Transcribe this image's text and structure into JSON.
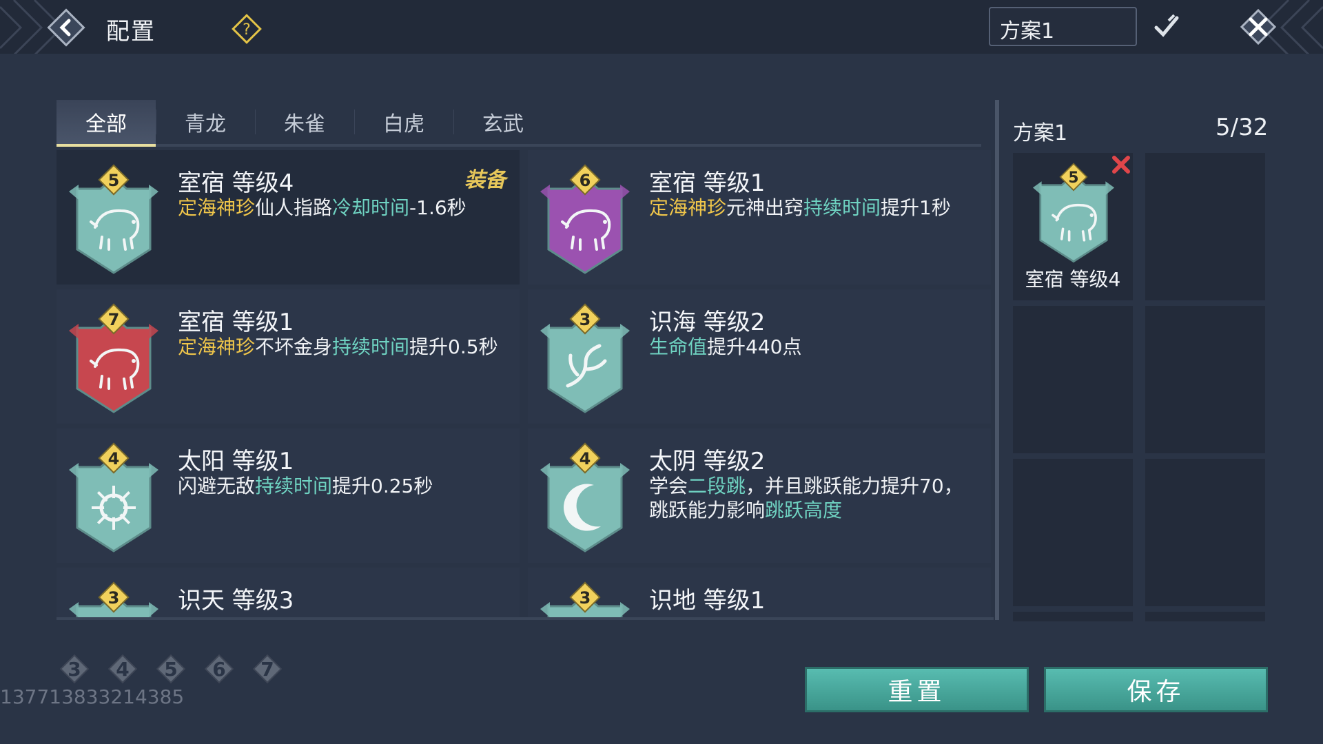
{
  "header": {
    "title": "配置",
    "scheme_value": "方案1"
  },
  "tabs": [
    {
      "label": "全部",
      "active": true
    },
    {
      "label": "青龙",
      "active": false
    },
    {
      "label": "朱雀",
      "active": false
    },
    {
      "label": "白虎",
      "active": false
    },
    {
      "label": "玄武",
      "active": false
    }
  ],
  "cards": [
    {
      "level": "5",
      "badge_color": "#7fbdb6",
      "icon": "pig-icon",
      "title": "室宿 等级4",
      "equip": "装备",
      "desc": [
        {
          "t": "定海神珍",
          "c": "gold"
        },
        {
          "t": "仙人指路",
          "c": "white"
        },
        {
          "t": "冷却时间",
          "c": "teal"
        },
        {
          "t": "-1.6秒",
          "c": "white"
        }
      ]
    },
    {
      "level": "6",
      "badge_color": "#9b52b0",
      "icon": "pig-icon",
      "title": "室宿 等级1",
      "desc": [
        {
          "t": "定海神珍",
          "c": "gold"
        },
        {
          "t": "元神出窍",
          "c": "white"
        },
        {
          "t": "持续时间",
          "c": "teal"
        },
        {
          "t": "提升1秒",
          "c": "white"
        }
      ]
    },
    {
      "level": "7",
      "badge_color": "#c7474f",
      "icon": "pig-icon",
      "title": "室宿 等级1",
      "desc": [
        {
          "t": "定海神珍",
          "c": "gold"
        },
        {
          "t": "不坏金身",
          "c": "white"
        },
        {
          "t": "持续时间",
          "c": "teal"
        },
        {
          "t": "提升0.5秒",
          "c": "white"
        }
      ]
    },
    {
      "level": "3",
      "badge_color": "#7fbdb6",
      "icon": "branch-icon",
      "title": "识海 等级2",
      "desc": [
        {
          "t": "生命值",
          "c": "teal"
        },
        {
          "t": "提升440点",
          "c": "white"
        }
      ]
    },
    {
      "level": "4",
      "badge_color": "#7fbdb6",
      "icon": "sun-icon",
      "title": "太阳 等级1",
      "desc": [
        {
          "t": "闪避无敌",
          "c": "white"
        },
        {
          "t": "持续时间",
          "c": "teal"
        },
        {
          "t": "提升0.25秒",
          "c": "white"
        }
      ]
    },
    {
      "level": "4",
      "badge_color": "#7fbdb6",
      "icon": "moon-icon",
      "title": "太阴 等级2",
      "desc": [
        {
          "t": "学会",
          "c": "white"
        },
        {
          "t": "二段跳",
          "c": "teal"
        },
        {
          "t": "，并且跳跃能力提升70，跳跃能力影响",
          "c": "white"
        },
        {
          "t": "跳跃高度",
          "c": "teal"
        }
      ]
    },
    {
      "level": "3",
      "badge_color": "#7fbdb6",
      "icon": "sky-icon",
      "title": "识天 等级3",
      "desc": []
    },
    {
      "level": "3",
      "badge_color": "#7fbdb6",
      "icon": "earth-icon",
      "title": "识地 等级1",
      "desc": []
    }
  ],
  "panel": {
    "plan_name": "方案1",
    "count": "5/32",
    "equipped": {
      "level": "5",
      "label": "室宿 等级4",
      "badge_color": "#7fbdb6"
    }
  },
  "filters": [
    "3",
    "4",
    "5",
    "6",
    "7"
  ],
  "uid": "137713833214385",
  "buttons": {
    "reset": "重置",
    "save": "保存"
  },
  "colors": {
    "accent_teal": "#4fa99e",
    "gold": "#f0c64a",
    "teal_text": "#6fd3c2",
    "remove_red": "#e0464a"
  }
}
